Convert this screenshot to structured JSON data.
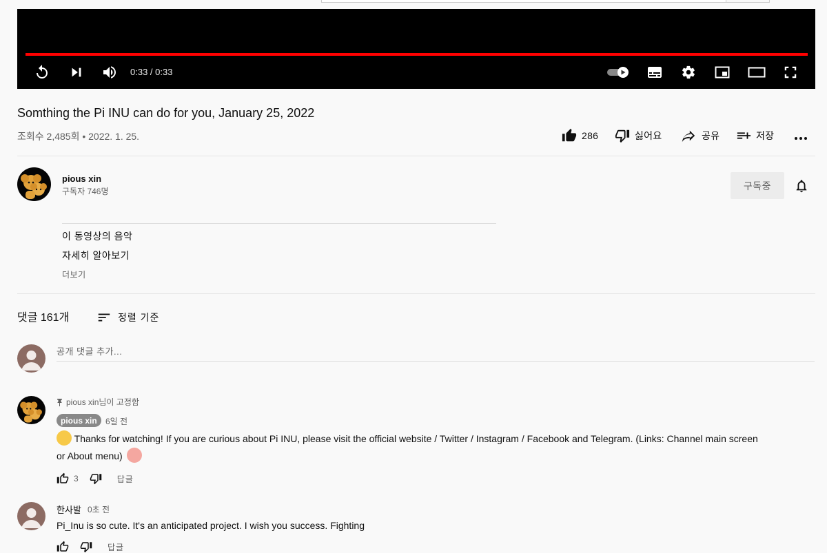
{
  "player": {
    "time": "0:33 / 0:33",
    "progress": 1.0,
    "accent": "#ff0000"
  },
  "video": {
    "title": "Somthing the Pi INU can do for you, January 25, 2022",
    "meta": "조회수 2,485회 • 2022. 1. 25.",
    "likes": "286",
    "dislike_label": "싫어요",
    "share_label": "공유",
    "save_label": "저장"
  },
  "channel": {
    "name": "pious xin",
    "subscribers": "구독자 746명",
    "subscribe_label": "구독중"
  },
  "description": {
    "line1": "이 동영상의 음악",
    "line2": "자세히 알아보기",
    "more": "더보기"
  },
  "comments": {
    "count": "댓글 161개",
    "sort_label": "정렬 기준",
    "add_placeholder": "공개 댓글 추가...",
    "reply_label": "답글",
    "items": [
      {
        "pinned": "pious xin님이 고정함",
        "author": "pious xin",
        "age": "6일 전",
        "text_line1": "Thanks for watching! If you are curious about Pi INU, please visit the official website / Twitter / Instagram / Facebook and Telegram. (Links: Channel main screen",
        "text_line2": "or About menu)",
        "likes": "3"
      },
      {
        "author": "한사발",
        "age": "0초 전",
        "text": "Pi_Inu is so cute. It's an anticipated project. I wish you success. Fighting"
      }
    ]
  }
}
